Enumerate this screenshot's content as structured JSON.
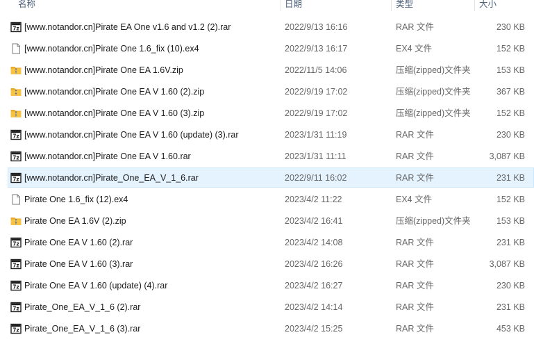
{
  "columns": {
    "name": "名称",
    "date": "日期",
    "type": "类型",
    "size": "大小"
  },
  "files": [
    {
      "name": "[www.notandor.cn]Pirate EA One v1.6 and v1.2 (2).rar",
      "date": "2022/9/13 16:16",
      "type": "RAR 文件",
      "size": "230 KB",
      "icon": "rar-icon",
      "selected": false
    },
    {
      "name": "[www.notandor.cn]Pirate One 1.6_fix (10).ex4",
      "date": "2022/9/13 16:17",
      "type": "EX4 文件",
      "size": "152 KB",
      "icon": "blank-file-icon",
      "selected": false
    },
    {
      "name": "[www.notandor.cn]Pirate One EA 1.6V.zip",
      "date": "2022/11/5 14:06",
      "type": "压缩(zipped)文件夹",
      "size": "153 KB",
      "icon": "zip-folder-icon",
      "selected": false
    },
    {
      "name": "[www.notandor.cn]Pirate One EA V 1.60 (2).zip",
      "date": "2022/9/19 17:02",
      "type": "压缩(zipped)文件夹",
      "size": "367 KB",
      "icon": "zip-folder-icon",
      "selected": false
    },
    {
      "name": "[www.notandor.cn]Pirate One EA V 1.60 (3).zip",
      "date": "2022/9/19 17:02",
      "type": "压缩(zipped)文件夹",
      "size": "152 KB",
      "icon": "zip-folder-icon",
      "selected": false
    },
    {
      "name": "[www.notandor.cn]Pirate One EA V 1.60 (update) (3).rar",
      "date": "2023/1/31 11:19",
      "type": "RAR 文件",
      "size": "230 KB",
      "icon": "rar-icon",
      "selected": false
    },
    {
      "name": "[www.notandor.cn]Pirate One EA V 1.60.rar",
      "date": "2023/1/31 11:11",
      "type": "RAR 文件",
      "size": "3,087 KB",
      "icon": "rar-icon",
      "selected": false
    },
    {
      "name": "[www.notandor.cn]Pirate_One_EA_V_1_6.rar",
      "date": "2022/9/11 16:02",
      "type": "RAR 文件",
      "size": "231 KB",
      "icon": "rar-icon",
      "selected": true
    },
    {
      "name": "Pirate One 1.6_fix (12).ex4",
      "date": "2023/4/2 11:22",
      "type": "EX4 文件",
      "size": "152 KB",
      "icon": "blank-file-icon",
      "selected": false
    },
    {
      "name": "Pirate One EA 1.6V (2).zip",
      "date": "2023/4/2 16:41",
      "type": "压缩(zipped)文件夹",
      "size": "153 KB",
      "icon": "zip-folder-icon",
      "selected": false
    },
    {
      "name": "Pirate One EA V 1.60 (2).rar",
      "date": "2023/4/2 14:08",
      "type": "RAR 文件",
      "size": "231 KB",
      "icon": "rar-icon",
      "selected": false
    },
    {
      "name": "Pirate One EA V 1.60 (3).rar",
      "date": "2023/4/2 16:26",
      "type": "RAR 文件",
      "size": "3,087 KB",
      "icon": "rar-icon",
      "selected": false
    },
    {
      "name": "Pirate One EA V 1.60 (update) (4).rar",
      "date": "2023/4/2 16:27",
      "type": "RAR 文件",
      "size": "230 KB",
      "icon": "rar-icon",
      "selected": false
    },
    {
      "name": "Pirate_One_EA_V_1_6 (2).rar",
      "date": "2023/4/2 14:14",
      "type": "RAR 文件",
      "size": "231 KB",
      "icon": "rar-icon",
      "selected": false
    },
    {
      "name": "Pirate_One_EA_V_1_6 (3).rar",
      "date": "2023/4/2 15:25",
      "type": "RAR 文件",
      "size": "453 KB",
      "icon": "rar-icon",
      "selected": false
    }
  ],
  "colors": {
    "selection_bg": "#e5f3ff",
    "selection_border": "#cce8ff",
    "header_text": "#4c607a",
    "secondary_text": "#666666",
    "zip_folder": "#f7c342"
  }
}
